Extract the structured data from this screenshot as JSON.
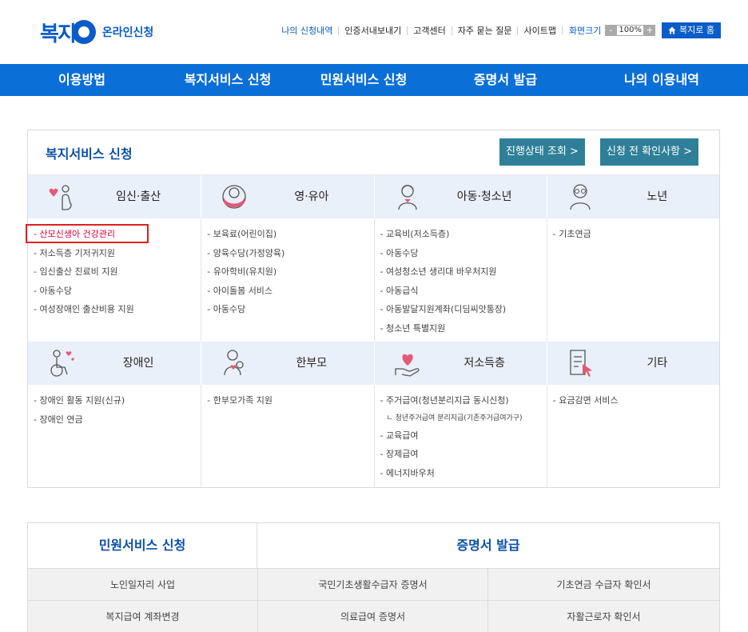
{
  "header": {
    "logo_main": "복지",
    "logo_sub": "온라인신청",
    "util_links": [
      "나의 신청내역",
      "인증서내보내기",
      "고객센터",
      "자주 묻는 질문",
      "사이트맵"
    ],
    "size_label": "화면크기",
    "zoom_minus": "-",
    "zoom_value": "100%",
    "zoom_plus": "+",
    "home_button": "복지로 홈"
  },
  "nav": {
    "items": [
      "이용방법",
      "복지서비스 신청",
      "민원서비스 신청",
      "증명서 발급",
      "나의 이용내역"
    ]
  },
  "welfare": {
    "title": "복지서비스 신청",
    "status_button": "진행상태 조회 >",
    "check_button": "신청 전 확인사항 >",
    "categories_top": [
      "임신·출산",
      "영·유아",
      "아동·청소년",
      "노년"
    ],
    "categories_bottom": [
      "장애인",
      "한부모",
      "저소득층",
      "기타"
    ],
    "lists_top": [
      [
        "- 산모신생아 건강관리",
        "- 저소득층 기저귀지원",
        "- 임신출산 진료비 지원",
        "- 아동수당",
        "- 여성장애인 출산비용 지원"
      ],
      [
        "- 보육료(어린이집)",
        "- 양육수당(가정양육)",
        "- 유아학비(유치원)",
        "- 아이돌봄 서비스",
        "- 아동수당"
      ],
      [
        "- 교육비(저소득층)",
        "- 아동수당",
        "- 여성청소년 생리대 바우처지원",
        "- 아동급식",
        "- 아동발달지원계좌(디딤씨앗통장)",
        "- 청소년 특별지원"
      ],
      [
        "- 기초연금"
      ]
    ],
    "lists_bottom": [
      [
        "- 장애인 활동 지원(신규)",
        "- 장애인 연금"
      ],
      [
        "- 한부모가족 지원"
      ],
      [
        "- 주거급여(청년분리지급 동시신청)",
        "ㄴ 청년주거급여 분리지급(기존주거급여가구)",
        "- 교육급여",
        "- 장제급여",
        "- 에너지바우처"
      ],
      [
        "- 요금감면 서비스"
      ]
    ]
  },
  "bottom": {
    "civil_title": "민원서비스 신청",
    "cert_title": "증명서 발급",
    "civil_items": [
      "노인일자리 사업",
      "복지급여 계좌변경"
    ],
    "cert_items": [
      "국민기초생활수급자 증명서",
      "기초연금 수급자 확인서",
      "의료급여 증명서",
      "자활근로자 확인서"
    ]
  },
  "colors": {
    "brand_blue": "#0a5cc8",
    "nav_blue": "#0a6fd6",
    "teal_button": "#2f7f99",
    "highlight_red": "#e02020"
  }
}
